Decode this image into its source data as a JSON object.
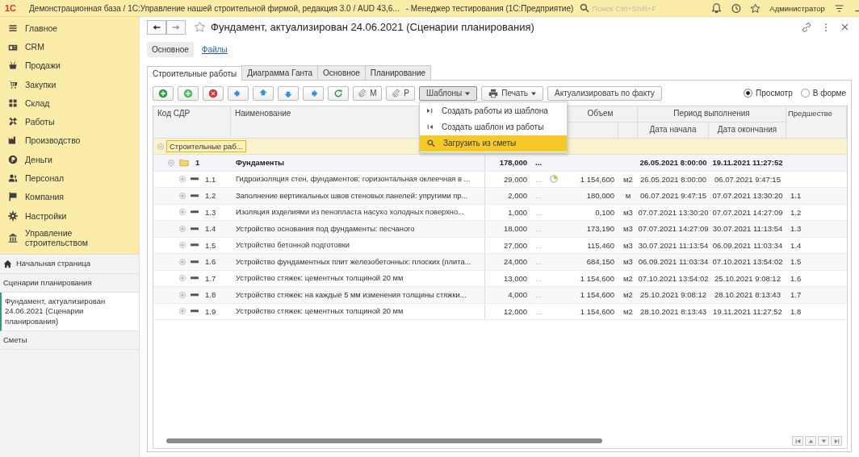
{
  "title_bar": {
    "logo": "1С",
    "title": "Демонстрационная база / 1С:Управление нашей строительной фирмой, редакция 3.0 / AUD 43,6...",
    "role": "- Менеджер тестирования (1С:Предприятие)",
    "search": {
      "placeholder": "Поиск Ctrl+Shift+F"
    },
    "user": "Администратор"
  },
  "sidebar": {
    "sections": [
      {
        "label": "Главное"
      },
      {
        "label": "CRM"
      },
      {
        "label": "Продажи"
      },
      {
        "label": "Закупки"
      },
      {
        "label": "Склад"
      },
      {
        "label": "Работы"
      },
      {
        "label": "Производство"
      },
      {
        "label": "Деньги"
      },
      {
        "label": "Персонал"
      },
      {
        "label": "Компания"
      },
      {
        "label": "Настройки"
      },
      {
        "label": "Управление строительством"
      }
    ],
    "open_windows": [
      {
        "label": "Начальная страница",
        "kind": "home",
        "selected": false
      },
      {
        "label": "Сценарии планирования",
        "kind": "window",
        "selected": false
      },
      {
        "label": "Фундамент, актуализирован 24.06.2021 (Сценарии планирования)",
        "kind": "window",
        "selected": true
      },
      {
        "label": "Сметы",
        "kind": "window",
        "selected": false
      }
    ]
  },
  "form": {
    "title": "Фундамент, актуализирован 24.06.2021 (Сценарии планирования)",
    "nav_tabs": [
      {
        "label": "Основное",
        "selected": true
      },
      {
        "label": "Файлы",
        "selected": false
      }
    ],
    "tabs": [
      {
        "label": "Строительные работы",
        "selected": true
      },
      {
        "label": "Диаграмма Ганта",
        "selected": false
      },
      {
        "label": "Основное",
        "selected": false
      },
      {
        "label": "Планирование",
        "selected": false
      }
    ],
    "toolbar": {
      "attach_buttons": [
        "М",
        "Р"
      ],
      "templates": {
        "label": "Шаблоны",
        "open": true
      },
      "print": "Печать",
      "actualize": "Актуализировать по факту"
    },
    "view_modes": [
      {
        "label": "Просмотр",
        "selected": true
      },
      {
        "label": "В форме",
        "selected": false
      }
    ],
    "templates_menu": [
      {
        "label": "Создать работы из шаблона",
        "selected": false
      },
      {
        "label": "Создать шаблон из работы",
        "selected": false
      },
      {
        "label": "Загрузить из сметы",
        "selected": true
      }
    ],
    "table": {
      "columns": {
        "code": "Код СДР",
        "name": "Наименование",
        "volume": "Объем",
        "period": "Период выполнения",
        "start": "Дата начала",
        "end": "Дата окончания",
        "predecessor": "Предшестве"
      },
      "rows": [
        {
          "kind": "group",
          "label": "Строительные раб...",
          "expanded": true,
          "children": [
            {
              "kind": "section",
              "code": "1",
              "name": "Фундаменты",
              "duration": "178,000",
              "more": "...",
              "start": "26.05.2021 8:00:00",
              "end": "19.11.2021 11:27:52",
              "expanded": true,
              "children": [
                {
                  "kind": "task",
                  "code": "1.1",
                  "name": "Гидроизоляция стен, фундаментов: горизонтальная оклеечная в ...",
                  "duration": "29,000",
                  "more": "...",
                  "in_progress": true,
                  "volume": "1 154,600",
                  "unit": "м2",
                  "start": "26.05.2021 8:00:00",
                  "end": "06.07.2021 9:47:15",
                  "expanded": false
                },
                {
                  "kind": "task",
                  "code": "1.2",
                  "name": "Заполнение вертикальных швов стеновых панелей: упругими пр...",
                  "duration": "2,000",
                  "more": "...",
                  "in_progress": false,
                  "volume": "180,000",
                  "unit": "м",
                  "start": "06.07.2021 9:47:15",
                  "end": "07.07.2021 13:30:20",
                  "predecessor": "1.1",
                  "expanded": false
                },
                {
                  "kind": "task",
                  "code": "1.3",
                  "name": "Изоляция изделиями из пенопласта насухо холодных поверхно...",
                  "duration": "1,000",
                  "more": "...",
                  "in_progress": false,
                  "volume": "0,100",
                  "unit": "м3",
                  "start": "07.07.2021 13:30:20",
                  "end": "07.07.2021 14:27:09",
                  "predecessor": "1.2",
                  "expanded": false
                },
                {
                  "kind": "task",
                  "code": "1.4",
                  "name": "Устройство основания под фундаменты: песчаного",
                  "duration": "18,000",
                  "more": "...",
                  "in_progress": false,
                  "volume": "173,190",
                  "unit": "м3",
                  "start": "07.07.2021 14:27:09",
                  "end": "30.07.2021 11:13:54",
                  "predecessor": "1.3",
                  "expanded": false
                },
                {
                  "kind": "task",
                  "code": "1.5",
                  "name": "Устройство бетонной подготовки",
                  "duration": "27,000",
                  "more": "...",
                  "in_progress": false,
                  "volume": "115,460",
                  "unit": "м3",
                  "start": "30.07.2021 11:13:54",
                  "end": "06.09.2021 11:03:34",
                  "predecessor": "1.4",
                  "expanded": false
                },
                {
                  "kind": "task",
                  "code": "1.6",
                  "name": "Устройство фундаментных плит железобетонных: плоских (плита...",
                  "duration": "24,000",
                  "more": "...",
                  "in_progress": false,
                  "volume": "684,150",
                  "unit": "м3",
                  "start": "06.09.2021 11:03:34",
                  "end": "07.10.2021 13:54:02",
                  "predecessor": "1.5",
                  "expanded": false
                },
                {
                  "kind": "task",
                  "code": "1.7",
                  "name": "Устройство стяжек: цементных толщиной 20 мм",
                  "duration": "13,000",
                  "more": "...",
                  "in_progress": false,
                  "volume": "1 154,600",
                  "unit": "м2",
                  "start": "07.10.2021 13:54:02",
                  "end": "25.10.2021 9:08:12",
                  "predecessor": "1.6",
                  "expanded": false
                },
                {
                  "kind": "task",
                  "code": "1.8",
                  "name": "Устройство стяжек: на каждые 5 мм изменения толщины стяжки...",
                  "duration": "4,000",
                  "more": "...",
                  "in_progress": false,
                  "volume": "1 154,600",
                  "unit": "м2",
                  "start": "25.10.2021 9:08:12",
                  "end": "28.10.2021 8:13:43",
                  "predecessor": "1.7",
                  "expanded": false
                },
                {
                  "kind": "task",
                  "code": "1.9",
                  "name": "Устройство стяжек: цементных толщиной 20 мм",
                  "duration": "12,000",
                  "more": "...",
                  "in_progress": false,
                  "volume": "1 154,600",
                  "unit": "м2",
                  "start": "28.10.2021 8:13:43",
                  "end": "19.11.2021 11:27:52",
                  "predecessor": "1.8",
                  "expanded": false
                }
              ]
            }
          ]
        }
      ]
    }
  }
}
